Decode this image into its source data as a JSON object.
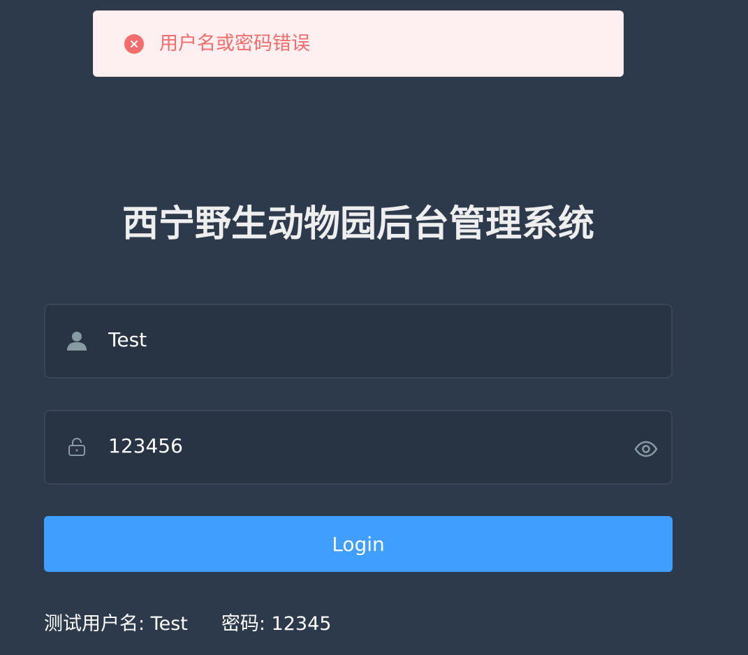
{
  "alert": {
    "message": "用户名或密码错误",
    "icon": "error-circle-icon",
    "color": "#f56c6c",
    "background": "#fef0f0"
  },
  "title": "西宁野生动物园后台管理系统",
  "form": {
    "username": {
      "icon": "user-icon",
      "value": "Test"
    },
    "password": {
      "icon": "lock-icon",
      "value": "123456",
      "toggle_icon": "eye-icon"
    },
    "login_label": "Login"
  },
  "tips": {
    "username_text": "测试用户名: Test",
    "password_text": "密码: 12345"
  },
  "colors": {
    "background": "#2d3a4b",
    "input_bg": "#283443",
    "accent": "#409eff"
  }
}
